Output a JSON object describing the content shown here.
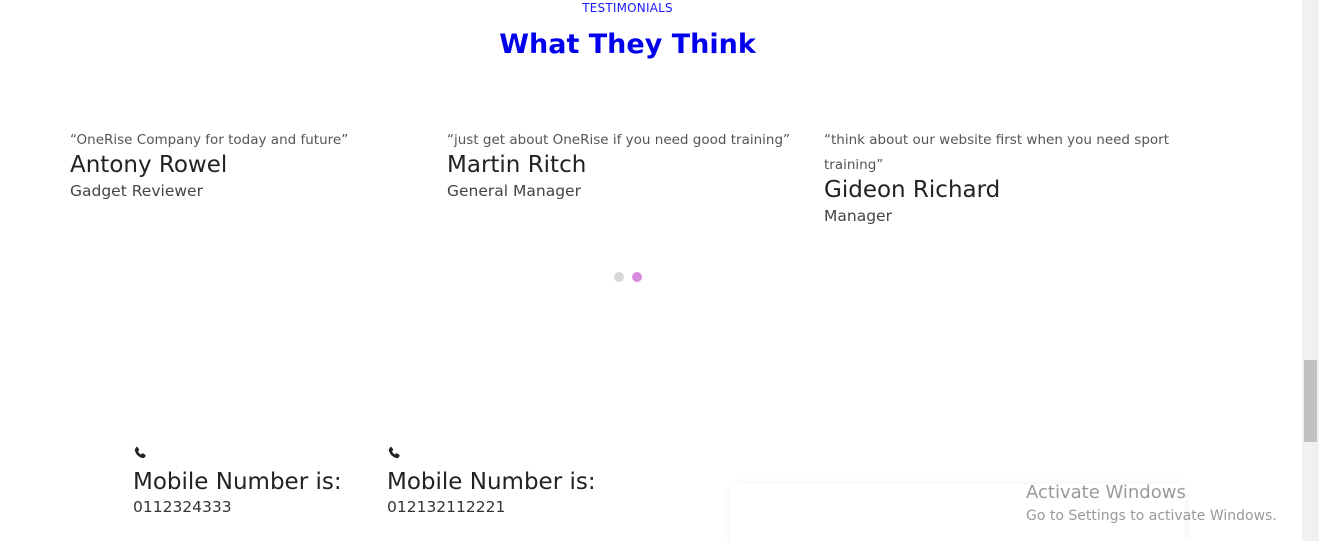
{
  "section": {
    "eyebrow": "TESTIMONIALS",
    "title": "What They Think"
  },
  "testimonials": [
    {
      "quote": "“OneRise Company for today and future”",
      "name": "Antony Rowel",
      "role": "Gadget Reviewer"
    },
    {
      "quote": "“just get about OneRise if you need good training”",
      "name": "Martin Ritch",
      "role": "General Manager"
    },
    {
      "quote": "“think about our website first when you need sport training”",
      "name": "Gideon Richard",
      "role": "Manager"
    }
  ],
  "carousel": {
    "dots": 2,
    "active_index": 1
  },
  "contacts": [
    {
      "icon": "phone-icon",
      "label": "Mobile Number is:",
      "number": "0112324333"
    },
    {
      "icon": "phone-icon",
      "label": "Mobile Number is:",
      "number": "012132112221"
    }
  ],
  "watermark": {
    "title": "Activate Windows",
    "subtitle": "Go to Settings to activate Windows."
  },
  "colors": {
    "heading": "#0000ee",
    "eyebrow": "#1a1aff",
    "dot_active": "#d88ae0",
    "dot_inactive": "#d8d8d8"
  }
}
